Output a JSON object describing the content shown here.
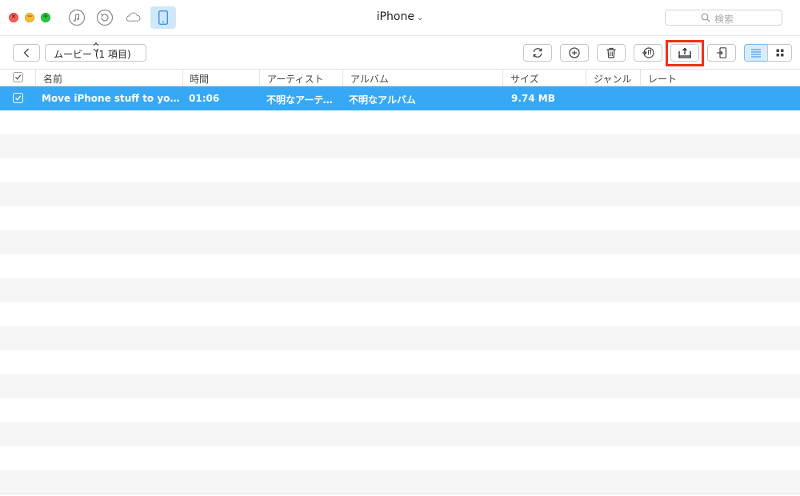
{
  "window": {
    "device_title": "iPhone",
    "search_placeholder": "検索"
  },
  "nav_icons": [
    "music-icon",
    "history-icon",
    "cloud-icon",
    "phone-icon"
  ],
  "toolbar": {
    "category_label": "ムービー (1 項目)",
    "buttons": [
      "refresh-icon",
      "add-icon",
      "delete-icon",
      "send-to-itunes-icon",
      "export-to-computer-icon",
      "send-to-device-icon",
      "list-view-icon",
      "grid-view-icon"
    ]
  },
  "table": {
    "columns": [
      "名前",
      "時間",
      "アーティスト",
      "アルバム",
      "サイズ",
      "ジャンル",
      "レート"
    ],
    "rows": [
      {
        "selected": true,
        "name": "Move iPhone stuff to your pho…",
        "time": "01:06",
        "artist": "不明なアーティ…",
        "album": "不明なアルバム",
        "size": "9.74 MB",
        "genre": "",
        "rate": ""
      }
    ]
  },
  "colors": {
    "selection": "#37a8f5",
    "highlight": "#f2301b",
    "active_tab": "#cfe7fb"
  }
}
